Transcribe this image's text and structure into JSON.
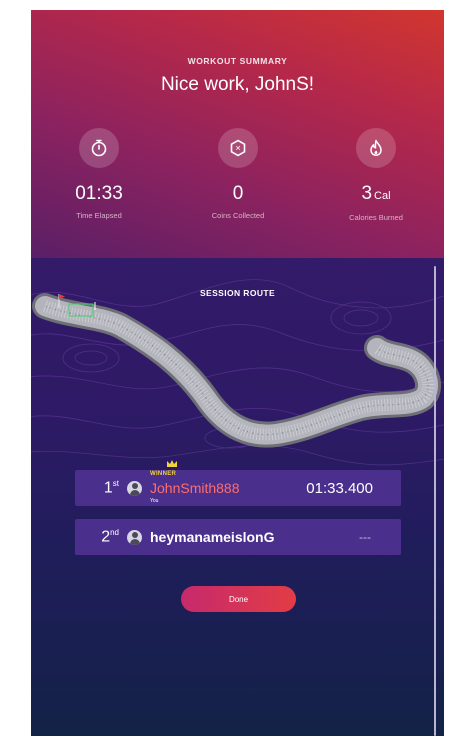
{
  "header": {
    "kicker": "WORKOUT SUMMARY",
    "title": "Nice work, JohnS!",
    "stats": [
      {
        "icon": "stopwatch-icon",
        "value": "01:33",
        "unit": "",
        "label": "Time Elapsed"
      },
      {
        "icon": "coin-icon",
        "value": "0",
        "unit": "",
        "label": "Coins Collected"
      },
      {
        "icon": "flame-icon",
        "value": "3",
        "unit": "Cal",
        "label": "Calories Burned"
      }
    ]
  },
  "route": {
    "title": "SESSION ROUTE"
  },
  "leaderboard": [
    {
      "rank": "1",
      "suffix": "st",
      "badge": "WINNER",
      "sub": "You",
      "name": "JohnSmith888",
      "time": "01:33.400"
    },
    {
      "rank": "2",
      "suffix": "nd",
      "name": "heymanameislonG",
      "time": "---"
    }
  ],
  "done_label": "Done",
  "colors": {
    "header_start": "#5a1f66",
    "header_end": "#d1362e",
    "row_bg": "#4b2f8c",
    "winner_name": "#ff6d6d",
    "winner_badge": "#f2d33a",
    "button_start": "#c62a6c",
    "button_end": "#e23c45"
  }
}
